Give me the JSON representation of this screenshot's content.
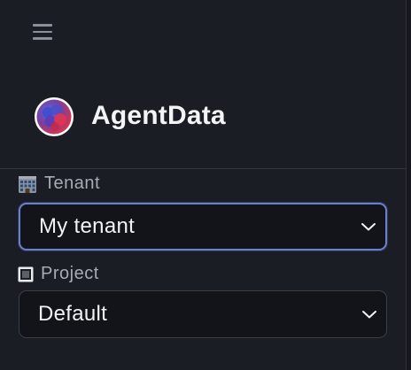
{
  "header": {
    "menu_icon": "hamburger-menu-icon",
    "app_name": "AgentData",
    "logo_icon": "agentdata-logo"
  },
  "tenant": {
    "icon": "office-building-emoji",
    "label": "Tenant",
    "selected": "My tenant",
    "focused": true
  },
  "project": {
    "icon": "black-square-button-emoji",
    "label": "Project",
    "selected": "Default"
  },
  "colors": {
    "background": "#1a1d24",
    "select_bg": "#12141a",
    "focus_border": "#6b7fd0",
    "logo_red": "#e0324a",
    "logo_blue": "#4a5bd6"
  }
}
